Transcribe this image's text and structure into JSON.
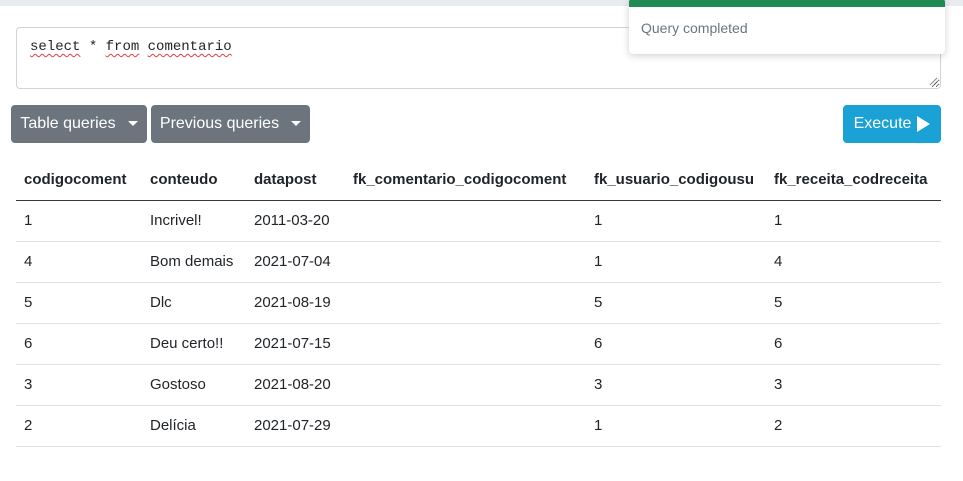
{
  "editor": {
    "query_text": "select * from comentario",
    "tokens": [
      "select",
      " * ",
      "from",
      " ",
      "comentario"
    ]
  },
  "toolbar": {
    "table_queries_label": "Table queries",
    "previous_queries_label": "Previous queries",
    "execute_label": "Execute"
  },
  "results": {
    "columns": [
      "codigocoment",
      "conteudo",
      "datapost",
      "fk_comentario_codigocoment",
      "fk_usuario_codigousu",
      "fk_receita_codreceita"
    ],
    "rows": [
      [
        "1",
        "Incrivel!",
        "2011-03-20",
        "",
        "1",
        "1"
      ],
      [
        "4",
        "Bom demais",
        "2021-07-04",
        "",
        "1",
        "4"
      ],
      [
        "5",
        "Dlc",
        "2021-08-19",
        "",
        "5",
        "5"
      ],
      [
        "6",
        "Deu certo!!",
        "2021-07-15",
        "",
        "6",
        "6"
      ],
      [
        "3",
        "Gostoso",
        "2021-08-20",
        "",
        "3",
        "3"
      ],
      [
        "2",
        "Delícia",
        "2021-07-29",
        "",
        "1",
        "2"
      ]
    ]
  },
  "toast": {
    "message": "Query completed",
    "accent_color": "#1f8a52"
  },
  "colors": {
    "button_grey": "#6c757d",
    "button_info": "#1aa1d6"
  }
}
